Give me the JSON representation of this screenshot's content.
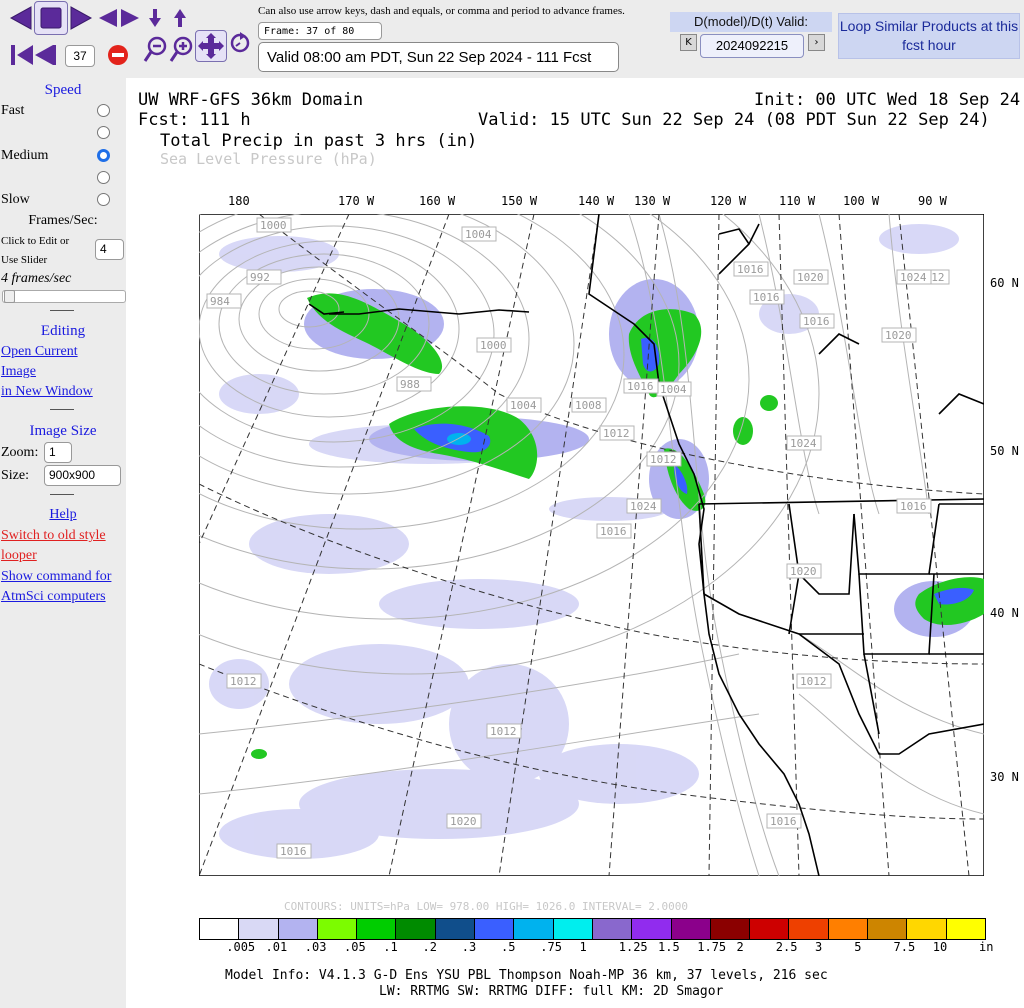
{
  "toolbar": {
    "frame_input": "37",
    "hint": "Can also use arrow keys, dash and equals, or comma and period to advance frames.",
    "frame_label": "Frame: 37 of 80",
    "valid_time": "Valid 08:00 am PDT, Sun 22 Sep 2024 - 111 Fcst",
    "dmodel_label": "D(model)/D(t) Valid:",
    "date_value": "2024092215",
    "prev_arrow": "K",
    "next_arrow": "›",
    "loop_button": "Loop Similar Products at this fcst hour"
  },
  "sidebar": {
    "speed_title": "Speed",
    "fast": "Fast",
    "medium": "Medium",
    "slow": "Slow",
    "fps_label": "Frames/Sec:",
    "click_edit": "Click to Edit or",
    "use_slider": "Use Slider",
    "fps_value": "4",
    "fps_readout": "4 frames/sec",
    "editing_title": "Editing",
    "open_current": "Open Current",
    "image": "Image",
    "in_new_window": "in New Window",
    "image_size_title": "Image Size",
    "zoom_label": "Zoom:",
    "zoom_value": "1",
    "size_label": "Size:",
    "size_value": "900x900",
    "help": "Help",
    "switch_old": "Switch to old style",
    "looper": "looper",
    "show_command": "Show command for",
    "atmsci": "AtmSci computers"
  },
  "map": {
    "title_left": "UW WRF-GFS 36km Domain",
    "title_right": "Init: 00 UTC Wed 18 Sep 24",
    "fcst": "Fcst:  111 h",
    "valid": "Valid: 15 UTC Sun 22 Sep 24 (08 PDT Sun 22 Sep 24)",
    "field1": "Total Precip in past 3 hrs (in)",
    "field2": "Sea Level Pressure (hPa)",
    "lon_labels": [
      "180",
      "170 W",
      "160 W",
      "150 W",
      "140 W",
      "130 W",
      "120 W",
      "110 W",
      "100 W",
      "90 W"
    ],
    "lat_labels": [
      "60 N",
      "50 N",
      "40 N",
      "30 N"
    ],
    "isobar_labels": [
      "1000",
      "992",
      "984",
      "1004",
      "1000",
      "988",
      "1004",
      "1016",
      "1020",
      "1016",
      "1016",
      "1012",
      "1004",
      "1008",
      "1012",
      "1016",
      "1012",
      "1020",
      "1024",
      "1016",
      "1024",
      "1024",
      "1016",
      "1020",
      "1012",
      "1016",
      "1020",
      "1012",
      "1012",
      "1016"
    ],
    "contour_info": "CONTOURS:  UNITS=hPa  LOW=  978.00      HIGH=  1026.0      INTERVAL=  2.0000",
    "legend_labels": [
      ".005",
      ".01",
      ".03",
      ".05",
      ".1",
      ".2",
      ".3",
      ".5",
      ".75",
      "1",
      "1.25",
      "1.5",
      "1.75",
      "2",
      "2.5",
      "3",
      "5",
      "7.5",
      "10",
      "in"
    ],
    "legend_colors": [
      "#ffffff",
      "#d9d9f5",
      "#b3b3f0",
      "#7cfc00",
      "#00cd00",
      "#008b00",
      "#104e8b",
      "#3a5fff",
      "#00b2ee",
      "#00eeee",
      "#8968cd",
      "#912cee",
      "#8b008b",
      "#8b0000",
      "#cd0000",
      "#ee4000",
      "#ff7f00",
      "#cd8500",
      "#ffd700",
      "#ffff00"
    ],
    "model_info_1": "Model Info: V4.1.3   G-D Ens YSU PBL  Thompson    Noah-MP   36 km,   37 levels,  216 sec",
    "model_info_2": "LW: RRTMG SW: RRTMG   DIFF: full   KM: 2D Smagor"
  }
}
